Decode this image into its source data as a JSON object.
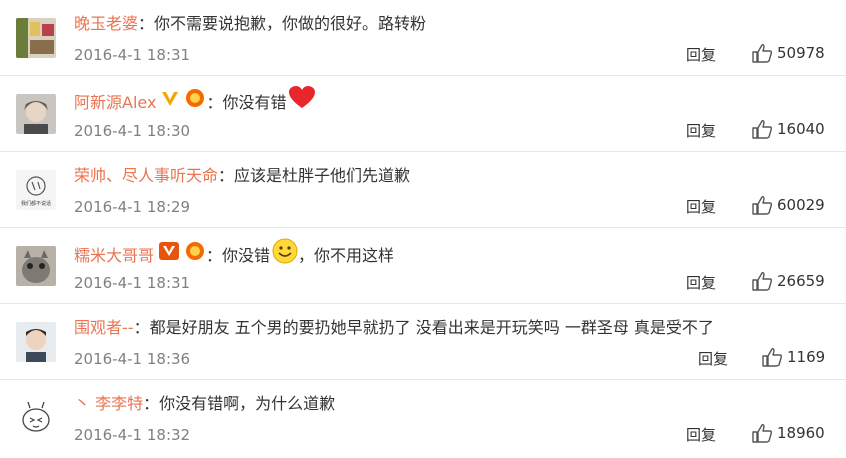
{
  "comments": [
    {
      "user": "晚玉老婆",
      "text": "：你不需要说抱歉，你做的很好。路转粉",
      "time": "2016-4-1 18:31",
      "reply": "回复",
      "likes": "50978"
    },
    {
      "user": "阿新源Alex",
      "text": "：你没有错",
      "time": "2016-4-1 18:30",
      "reply": "回复",
      "likes": "16040"
    },
    {
      "user": "荣帅、尽人事听天命",
      "text": "：应该是杜胖子他们先道歉",
      "time": "2016-4-1 18:29",
      "reply": "回复",
      "likes": "60029"
    },
    {
      "user": "糯米大哥哥",
      "text_before": "：你没错",
      "text_after": "，你不用这样",
      "time": "2016-4-1 18:31",
      "reply": "回复",
      "likes": "26659"
    },
    {
      "user": "围观者--",
      "text": "：都是好朋友 五个男的要扔她早就扔了 没看出来是开玩笑吗 一群圣母 真是受不了",
      "time": "2016-4-1 18:36",
      "reply": "回复",
      "likes": "1169"
    },
    {
      "user": "丶 李李特",
      "text": "：你没有错啊，为什么道歉",
      "time": "2016-4-1 18:32",
      "reply": "回复",
      "likes": "18960"
    }
  ],
  "avatar3_text": "我们都不说话",
  "colors": {
    "username": "#eb7350",
    "time": "#808080",
    "text": "#333333",
    "verified": "#f7a600",
    "vip": "#f56a00"
  }
}
